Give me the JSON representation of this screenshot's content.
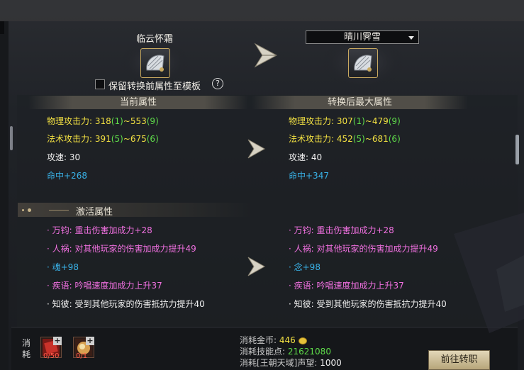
{
  "source_weapon": {
    "name": "临云怀霜",
    "icon": "fan-weapon-icon"
  },
  "target_weapon": {
    "name": "晴川霁雪",
    "icon": "fan-weapon-icon"
  },
  "keep_template": {
    "label": "保留转换前属性至模板",
    "checked": false,
    "help": "?"
  },
  "columns": {
    "current": "当前属性",
    "converted": "转换后最大属性"
  },
  "current_stats": {
    "phys_label": "物理攻击力:",
    "phys_lo": "318",
    "phys_lo_b": "(1)",
    "phys_sep": "~553",
    "phys_hi_b": "(9)",
    "mag_label": "法术攻击力:",
    "mag_lo": "391",
    "mag_lo_b": "(5)",
    "mag_sep": "~675",
    "mag_hi_b": "(6)",
    "speed": "攻速: 30",
    "hit": "命中+268"
  },
  "converted_stats": {
    "phys_label": "物理攻击力:",
    "phys_lo": "307",
    "phys_lo_b": "(1)",
    "phys_sep": "~479",
    "phys_hi_b": "(9)",
    "mag_label": "法术攻击力:",
    "mag_lo": "452",
    "mag_lo_b": "(5)",
    "mag_sep": "~681",
    "mag_hi_b": "(6)",
    "speed": "攻速: 40",
    "hit": "命中+347"
  },
  "activation": {
    "title": "激活属性",
    "current": [
      "· 万钧: 重击伤害加成力+28",
      "· 人祸: 对其他玩家的伤害加成力提升49",
      "· 魂+98",
      "· 疾语: 吟唱速度加成力上升37",
      "· 知彼: 受到其他玩家的伤害抵抗力提升40"
    ],
    "converted": [
      "· 万钧: 重击伤害加成力+28",
      "· 人祸: 对其他玩家的伤害加成力提升49",
      "· 念+98",
      "· 疾语: 吟唱速度加成力上升37",
      "· 知彼: 受到其他玩家的伤害抵抗力提升40"
    ]
  },
  "consume": {
    "label_1": "消",
    "label_2": "耗",
    "items": [
      {
        "count": "0/50",
        "plus": "+"
      },
      {
        "count": "0/1",
        "plus": "+"
      }
    ],
    "gold_label": "消耗金币:",
    "gold_value": "446",
    "skill_label": "消耗技能点:",
    "skill_value": "21621080",
    "rep_label": "消耗[王朝天域]声望:",
    "rep_value": "1000"
  },
  "button": {
    "label": "前往转职"
  },
  "colors": {
    "gold": "#f2e042",
    "green": "#5fdc4a",
    "blue": "#39b2e8",
    "purple": "#d05cc8"
  }
}
